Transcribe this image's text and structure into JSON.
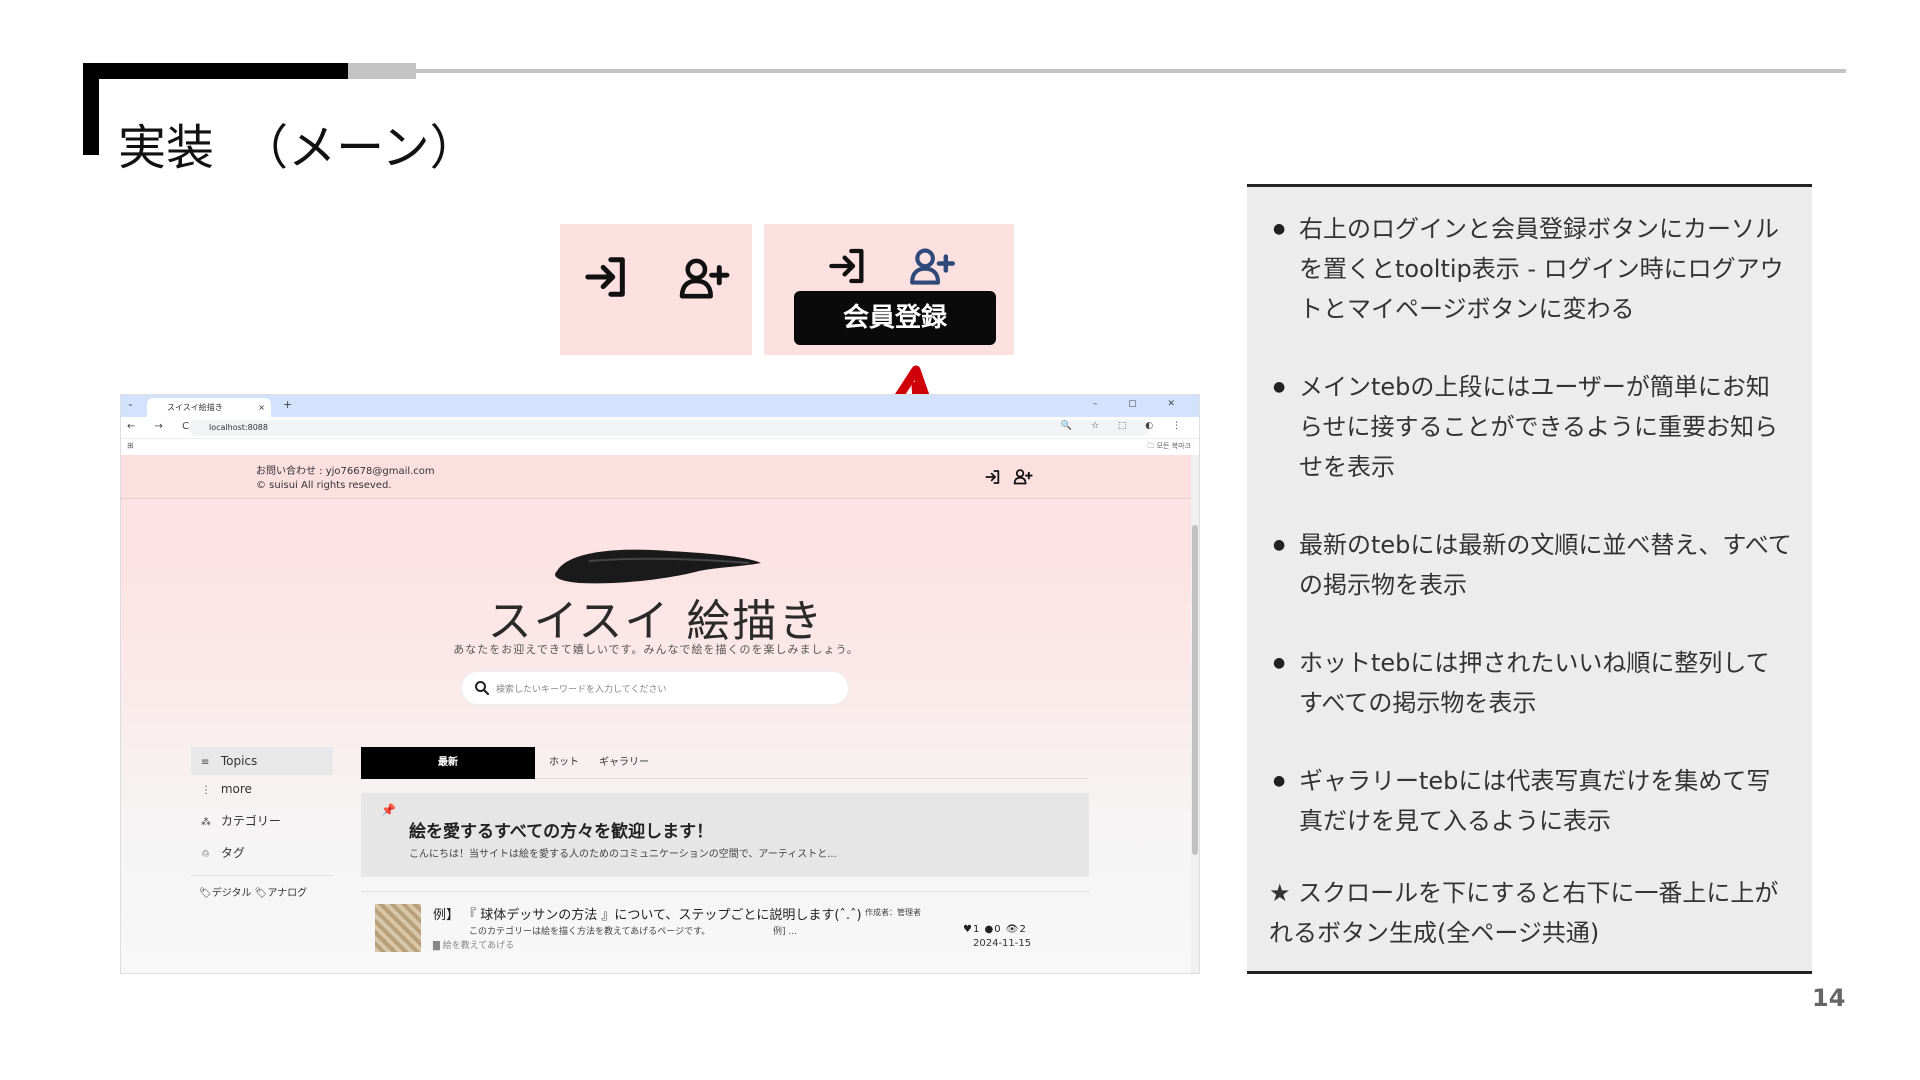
{
  "slide": {
    "title": "実装\t（メーン）",
    "page_number": "14"
  },
  "zoom": {
    "tooltip_label": "会員登録",
    "icons": [
      "login-icon",
      "person-add-icon"
    ]
  },
  "browser": {
    "tab_title": "スイスイ絵描き",
    "tab_close": "×",
    "tab_new": "+",
    "tab_dropdown": "⌄",
    "window_controls": "–  ▢  ✕",
    "nav_buttons": "← → C",
    "url": "localhost:8088",
    "address_icons": "🔍 ☆ ⬚ ◐ ⋮",
    "bookmarks_apps": "⊞",
    "bookmarks_right": "🗀 모든 북마크"
  },
  "site": {
    "contact_line": "お問い合わせ : yjo76678@gmail.com",
    "copyright": "© suisui All rights reseved.",
    "title": "スイスイ 絵描き",
    "subtitle": "あなたをお迎えできて嬉しいです。みんなで絵を描くのを楽しみましょう。",
    "search_placeholder": "検索したいキーワードを入力してください",
    "sidebar": {
      "items": [
        {
          "icon": "≡",
          "label": "Topics"
        },
        {
          "icon": "⋮",
          "label": "more"
        },
        {
          "icon": "⁂",
          "label": "カテゴリー"
        },
        {
          "icon": "♲",
          "label": "タグ"
        }
      ],
      "tags": "🏷デジタル 🏷アナログ"
    },
    "tabs": {
      "latest": "最新",
      "hot": "ホット",
      "gallery": "ギャラリー"
    },
    "notice": {
      "pin": "📌",
      "title": "絵を愛するすべての方々を歓迎します！",
      "body": "こんにちは！当サイトは絵を愛する人のためのコミュニケーションの空間で、アーティストと..."
    },
    "post": {
      "title": "例】 『 球体デッサンの方法 』について、ステップごとに説明します(ˆ.ˆ)",
      "author": "作成者：管理者",
      "body": "このカテゴリーは絵を描く方法を教えてあげるページです。",
      "more": "例] ...",
      "category": "▇ 絵を教えてあげる",
      "likes": "♥1",
      "comments": "●0",
      "views": "👁2",
      "date": "2024-11-15"
    }
  },
  "panel": {
    "bullets": [
      "右上のログインと会員登録ボタンにカーソルを置くとtooltip表示 - ログイン時にログアウトとマイページボタンに変わる",
      "メインtebの上段にはユーザーが簡単にお知らせに接することができるように重要お知らせを表示",
      "最新のtebには最新の文順に並べ替え、すべての掲示物を表示",
      "ホットtebには押されたいいね順に整列してすべての掲示物を表示",
      "ギャラリーtebには代表写真だけを集めて写真だけを見て入るように表示"
    ],
    "note": "★ スクロールを下にすると右下に一番上に上がれるボタン生成(全ページ共通)"
  }
}
